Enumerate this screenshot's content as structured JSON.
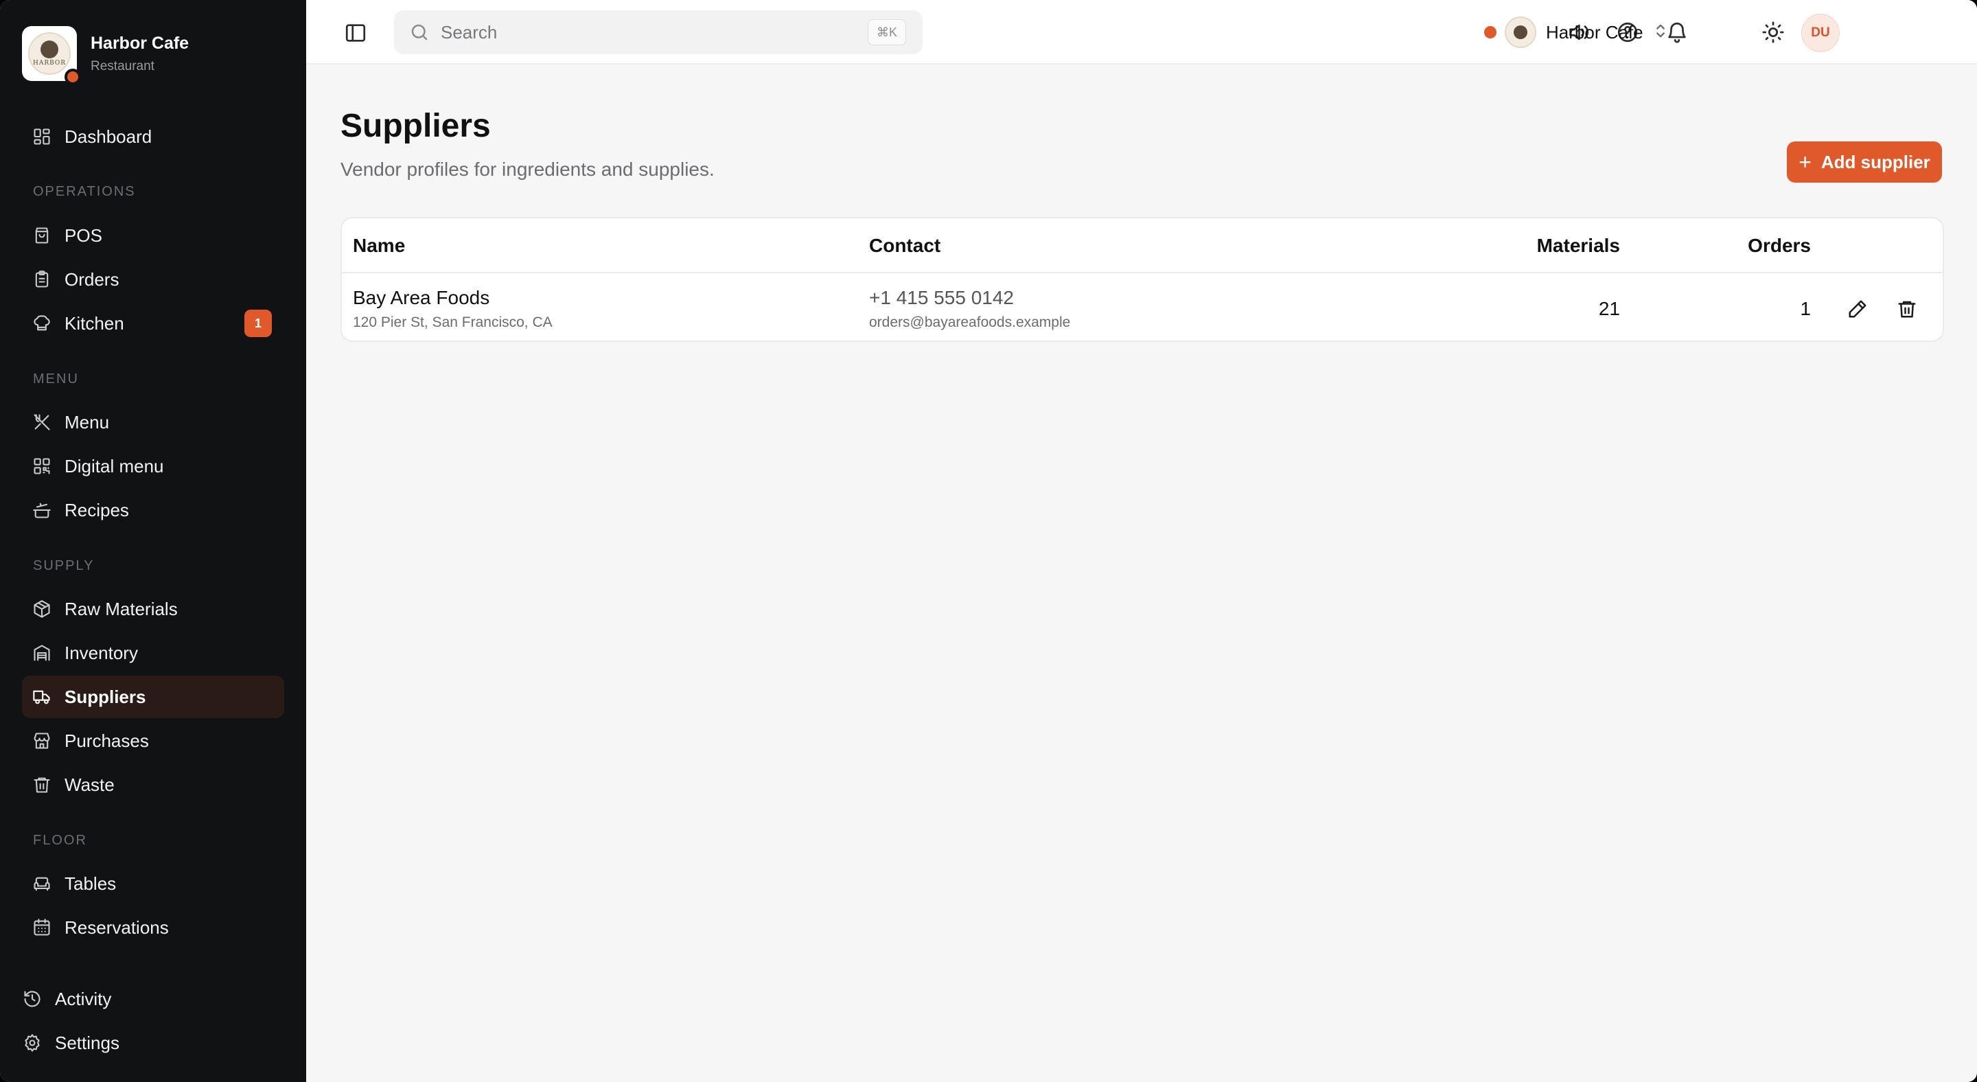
{
  "brand": {
    "name": "Harbor Cafe",
    "subtitle": "Restaurant",
    "logo_word": "HARBOR"
  },
  "sidebar": {
    "items": [
      {
        "label": "Dashboard",
        "icon": "dashboard-icon"
      },
      {
        "label": "POS",
        "icon": "shopping-bag-icon"
      },
      {
        "label": "Orders",
        "icon": "clipboard-icon"
      },
      {
        "label": "Kitchen",
        "icon": "chef-hat-icon",
        "badge": "1"
      },
      {
        "label": "Menu",
        "icon": "utensils-icon"
      },
      {
        "label": "Digital menu",
        "icon": "qr-code-icon"
      },
      {
        "label": "Recipes",
        "icon": "cooking-pot-icon"
      },
      {
        "label": "Raw Materials",
        "icon": "package-icon"
      },
      {
        "label": "Inventory",
        "icon": "warehouse-icon"
      },
      {
        "label": "Suppliers",
        "icon": "truck-icon",
        "active": true
      },
      {
        "label": "Purchases",
        "icon": "store-icon"
      },
      {
        "label": "Waste",
        "icon": "trash-icon"
      },
      {
        "label": "Tables",
        "icon": "sofa-icon"
      },
      {
        "label": "Reservations",
        "icon": "calendar-icon"
      }
    ],
    "sections": {
      "operations": "OPERATIONS",
      "menu": "MENU",
      "supply": "SUPPLY",
      "floor": "FLOOR"
    },
    "bottom": [
      {
        "label": "Activity",
        "icon": "history-icon"
      },
      {
        "label": "Settings",
        "icon": "gear-icon"
      }
    ]
  },
  "topbar": {
    "search_placeholder": "Search",
    "search_shortcut": "⌘K",
    "org_name": "Harbor Cafe",
    "avatar_initials": "DU"
  },
  "page": {
    "title": "Suppliers",
    "subtitle": "Vendor profiles for ingredients and supplies.",
    "add_button": "Add supplier"
  },
  "table": {
    "columns": {
      "name": "Name",
      "contact": "Contact",
      "materials": "Materials",
      "orders": "Orders"
    },
    "rows": [
      {
        "name": "Bay Area Foods",
        "address": "120 Pier St, San Francisco, CA",
        "phone": "+1 415 555 0142",
        "email": "orders@bayareafoods.example",
        "materials": "21",
        "orders": "1"
      }
    ]
  },
  "colors": {
    "accent": "#e0592a",
    "sidebar_bg": "#111214",
    "active_bg": "#2a1b17"
  }
}
